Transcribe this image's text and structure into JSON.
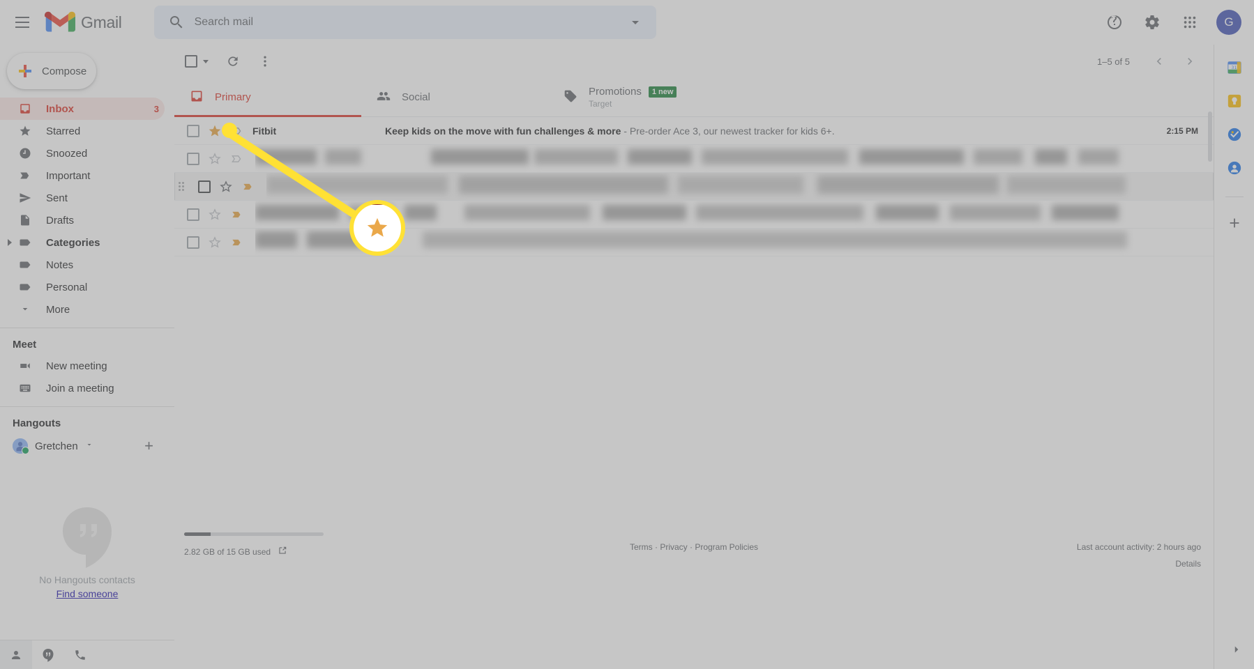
{
  "app": {
    "brand": "Gmail",
    "menu_icon": "hamburger-icon"
  },
  "search": {
    "placeholder": "Search mail",
    "value": "",
    "icon": "search-icon",
    "options_icon": "search-options-icon"
  },
  "header_actions": [
    {
      "name": "help-icon",
      "label": "Help"
    },
    {
      "name": "settings-icon",
      "label": "Settings"
    },
    {
      "name": "apps-grid-icon",
      "label": "Google apps"
    }
  ],
  "account": {
    "initial": "G",
    "color": "#3f51b5"
  },
  "sidebar": {
    "compose_label": "Compose",
    "items": [
      {
        "label": "Inbox",
        "icon": "inbox-icon",
        "count": "3",
        "active": true,
        "bold": true
      },
      {
        "label": "Starred",
        "icon": "star-icon",
        "count": "",
        "active": false,
        "bold": false
      },
      {
        "label": "Snoozed",
        "icon": "clock-icon",
        "count": "",
        "active": false,
        "bold": false
      },
      {
        "label": "Important",
        "icon": "important-icon",
        "count": "",
        "active": false,
        "bold": false
      },
      {
        "label": "Sent",
        "icon": "send-icon",
        "count": "",
        "active": false,
        "bold": false
      },
      {
        "label": "Drafts",
        "icon": "draft-icon",
        "count": "",
        "active": false,
        "bold": false
      },
      {
        "label": "Categories",
        "icon": "label-icon",
        "count": "",
        "active": false,
        "bold": true,
        "expandable": true
      },
      {
        "label": "Notes",
        "icon": "label-icon",
        "count": "",
        "active": false,
        "bold": false
      },
      {
        "label": "Personal",
        "icon": "label-icon",
        "count": "",
        "active": false,
        "bold": false
      },
      {
        "label": "More",
        "icon": "chevron-down-icon",
        "count": "",
        "active": false,
        "bold": false
      }
    ],
    "meet": {
      "title": "Meet",
      "items": [
        {
          "label": "New meeting",
          "icon": "video-camera-icon"
        },
        {
          "label": "Join a meeting",
          "icon": "keyboard-icon"
        }
      ]
    },
    "hangouts": {
      "title": "Hangouts",
      "user": "Gretchen",
      "status": "online",
      "add_icon": "plus-icon",
      "empty_text": "No Hangouts contacts",
      "empty_link": "Find someone",
      "bar_icons": [
        "contacts-icon",
        "hangouts-icon",
        "phone-icon"
      ]
    }
  },
  "toolbar": {
    "select_all_icon": "checkbox-icon",
    "select_all_caret": "chevron-down-icon",
    "refresh_icon": "refresh-icon",
    "more_icon": "more-vertical-icon",
    "pager_text": "1–5 of 5",
    "prev_icon": "chevron-left-icon",
    "next_icon": "chevron-right-icon"
  },
  "tabs": [
    {
      "label": "Primary",
      "icon": "inbox-icon",
      "active": true,
      "badge": "",
      "sub": ""
    },
    {
      "label": "Social",
      "icon": "people-icon",
      "active": false,
      "badge": "",
      "sub": ""
    },
    {
      "label": "Promotions",
      "icon": "tag-icon",
      "active": false,
      "badge": "1 new",
      "sub": "Target"
    }
  ],
  "emails": [
    {
      "sender": "Fitbit",
      "subject": "Keep kids on the move with fun challenges & more",
      "snippet": " - Pre-order Ace 3, our newest tracker for kids 6+.",
      "time": "2:15 PM",
      "starred": true,
      "important": false,
      "blurred": false
    },
    {
      "sender": "",
      "subject": "",
      "snippet": "",
      "time": "",
      "starred": false,
      "important": false,
      "blurred": true,
      "hover": false
    },
    {
      "sender": "",
      "subject": "",
      "snippet": "",
      "time": "",
      "starred": false,
      "important": true,
      "blurred": true,
      "hover": true
    },
    {
      "sender": "",
      "subject": "",
      "snippet": "",
      "time": "",
      "starred": false,
      "important": true,
      "blurred": true,
      "hover": false
    },
    {
      "sender": "",
      "subject": "",
      "snippet": "",
      "time": "",
      "starred": false,
      "important": true,
      "blurred": true,
      "hover": false
    }
  ],
  "footer": {
    "storage_text": "2.82 GB of 15 GB used",
    "storage_percent": 19,
    "storage_link_icon": "open-external-icon",
    "links": "Terms · Privacy · Program Policies",
    "activity": "Last account activity: 2 hours ago",
    "details": "Details"
  },
  "right_panel": {
    "icons": [
      "google-calendar-icon",
      "google-keep-icon",
      "google-tasks-icon",
      "google-contacts-icon"
    ],
    "add_icon": "plus-icon",
    "expand_icon": "chevron-right-icon"
  },
  "annotation": {
    "type": "callout-magnifier",
    "highlight_color": "#ffe135",
    "target": "star-icon-on-first-email-row",
    "zoomed_glyph": "star-icon"
  }
}
